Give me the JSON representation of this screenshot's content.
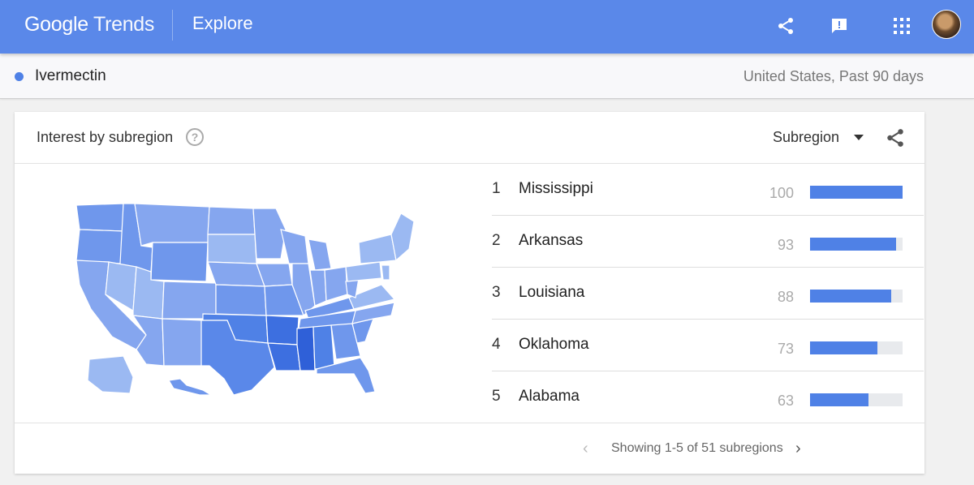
{
  "header": {
    "logo_google": "Google",
    "logo_trends": "Trends",
    "section": "Explore",
    "icons": [
      "share-icon",
      "feedback-icon",
      "apps-grid-icon",
      "avatar"
    ]
  },
  "term": {
    "label": "Ivermectin",
    "color": "#4f81e6",
    "meta": "United States, Past 90 days"
  },
  "card": {
    "title": "Interest by subregion",
    "resolution_select": "Subregion",
    "rankings": [
      {
        "rank": "1",
        "name": "Mississippi",
        "value": "100",
        "fraction": 1.0
      },
      {
        "rank": "2",
        "name": "Arkansas",
        "value": "93",
        "fraction": 0.93
      },
      {
        "rank": "3",
        "name": "Louisiana",
        "value": "88",
        "fraction": 0.88
      },
      {
        "rank": "4",
        "name": "Oklahoma",
        "value": "73",
        "fraction": 0.73
      },
      {
        "rank": "5",
        "name": "Alabama",
        "value": "63",
        "fraction": 0.63
      }
    ],
    "pager": {
      "text": "Showing 1-5 of 51 subregions"
    }
  },
  "colors": {
    "accent": "#5a88e9",
    "bar": "#4f81e6",
    "map_dark": "#3d6fe0",
    "map_mid": "#6f97ec",
    "map_light": "#9bb9f2"
  }
}
